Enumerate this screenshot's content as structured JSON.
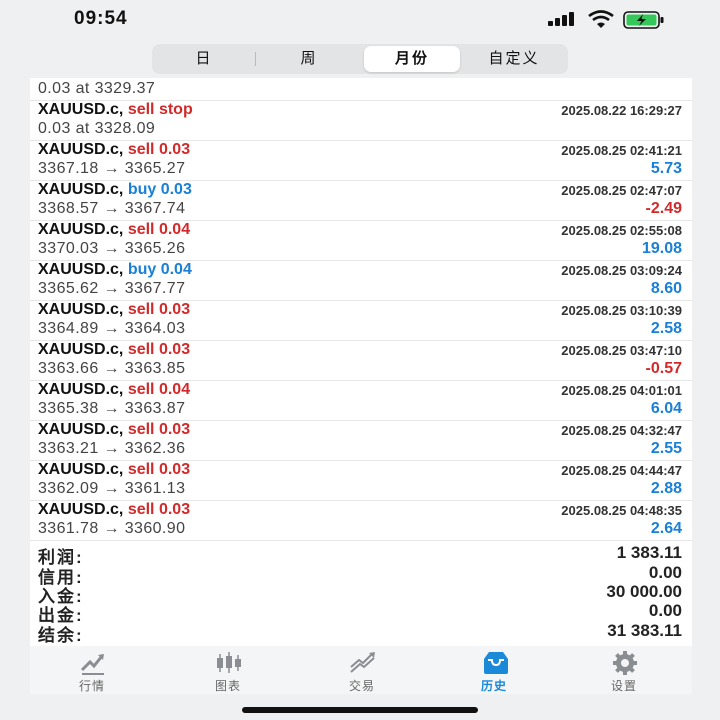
{
  "status_bar": {
    "time": "09:54"
  },
  "segments": [
    {
      "label": "日",
      "active": false
    },
    {
      "label": "周",
      "active": false
    },
    {
      "label": "月份",
      "active": true
    },
    {
      "label": "自定义",
      "active": false
    }
  ],
  "partial_row": {
    "price": "0.03 at 3329.37"
  },
  "pending_row": {
    "symbol": "XAUUSD.c,",
    "order": "sell stop",
    "date": "2025.08.22 16:29:27",
    "price": "0.03 at 3328.09"
  },
  "trades": [
    {
      "symbol": "XAUUSD.c,",
      "action": "sell 0.03",
      "side": "sell",
      "date": "2025.08.25 02:41:21",
      "prices": "3367.18 → 3365.27",
      "profit": "5.73",
      "sign": "pos"
    },
    {
      "symbol": "XAUUSD.c,",
      "action": "buy 0.03",
      "side": "buy",
      "date": "2025.08.25 02:47:07",
      "prices": "3368.57 → 3367.74",
      "profit": "-2.49",
      "sign": "neg"
    },
    {
      "symbol": "XAUUSD.c,",
      "action": "sell 0.04",
      "side": "sell",
      "date": "2025.08.25 02:55:08",
      "prices": "3370.03 → 3365.26",
      "profit": "19.08",
      "sign": "pos"
    },
    {
      "symbol": "XAUUSD.c,",
      "action": "buy 0.04",
      "side": "buy",
      "date": "2025.08.25 03:09:24",
      "prices": "3365.62 → 3367.77",
      "profit": "8.60",
      "sign": "pos"
    },
    {
      "symbol": "XAUUSD.c,",
      "action": "sell 0.03",
      "side": "sell",
      "date": "2025.08.25 03:10:39",
      "prices": "3364.89 → 3364.03",
      "profit": "2.58",
      "sign": "pos"
    },
    {
      "symbol": "XAUUSD.c,",
      "action": "sell 0.03",
      "side": "sell",
      "date": "2025.08.25 03:47:10",
      "prices": "3363.66 → 3363.85",
      "profit": "-0.57",
      "sign": "neg"
    },
    {
      "symbol": "XAUUSD.c,",
      "action": "sell 0.04",
      "side": "sell",
      "date": "2025.08.25 04:01:01",
      "prices": "3365.38 → 3363.87",
      "profit": "6.04",
      "sign": "pos"
    },
    {
      "symbol": "XAUUSD.c,",
      "action": "sell 0.03",
      "side": "sell",
      "date": "2025.08.25 04:32:47",
      "prices": "3363.21 → 3362.36",
      "profit": "2.55",
      "sign": "pos"
    },
    {
      "symbol": "XAUUSD.c,",
      "action": "sell 0.03",
      "side": "sell",
      "date": "2025.08.25 04:44:47",
      "prices": "3362.09 → 3361.13",
      "profit": "2.88",
      "sign": "pos"
    },
    {
      "symbol": "XAUUSD.c,",
      "action": "sell 0.03",
      "side": "sell",
      "date": "2025.08.25 04:48:35",
      "prices": "3361.78 → 3360.90",
      "profit": "2.64",
      "sign": "pos"
    }
  ],
  "summary": [
    {
      "label": "利润:",
      "value": "1 383.11"
    },
    {
      "label": "信用:",
      "value": "0.00"
    },
    {
      "label": "入金:",
      "value": "30 000.00"
    },
    {
      "label": "出金:",
      "value": "0.00"
    },
    {
      "label": "结余:",
      "value": "31 383.11"
    }
  ],
  "tabs": [
    {
      "label": "行情",
      "icon": "quotes-icon",
      "active": false
    },
    {
      "label": "图表",
      "icon": "chart-icon",
      "active": false
    },
    {
      "label": "交易",
      "icon": "trade-icon",
      "active": false
    },
    {
      "label": "历史",
      "icon": "history-icon",
      "active": true
    },
    {
      "label": "设置",
      "icon": "settings-icon",
      "active": false
    }
  ],
  "colors": {
    "sell": "#d22a2a",
    "buy": "#1a7fd6",
    "active_tab": "#1a8ad8"
  }
}
